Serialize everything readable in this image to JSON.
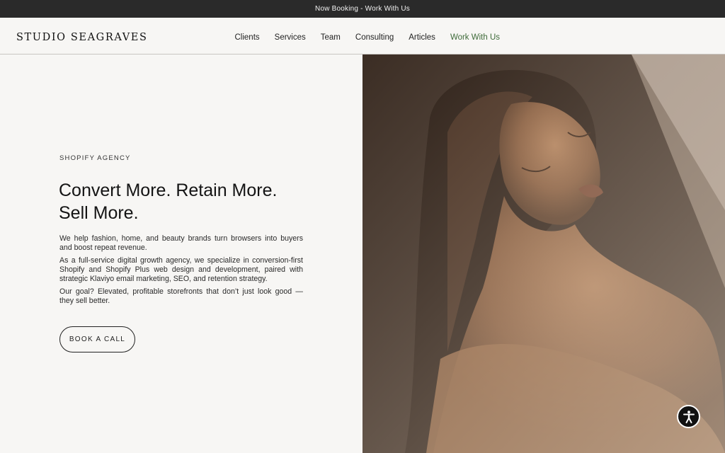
{
  "announcement": {
    "text": "Now Booking - Work With Us"
  },
  "brand": {
    "name": "STUDIO SEAGRAVES"
  },
  "nav": {
    "items": [
      {
        "label": "Clients"
      },
      {
        "label": "Services"
      },
      {
        "label": "Team"
      },
      {
        "label": "Consulting"
      },
      {
        "label": "Articles"
      },
      {
        "label": "Work With Us"
      }
    ]
  },
  "hero": {
    "eyebrow": "SHOPIFY AGENCY",
    "headline_line1": "Convert More. Retain More.",
    "headline_line2": "Sell More.",
    "paragraphs": [
      "We help fashion, home, and beauty brands turn browsers into buyers and boost repeat revenue.",
      "As a full-service digital growth agency, we specialize in conversion-first Shopify and Shopify Plus web design and development, paired with strategic Klaviyo email marketing, SEO, and retention strategy.",
      "Our goal? Elevated, profitable storefronts that don’t just look good — they sell better."
    ],
    "cta_label": "BOOK A CALL",
    "image_icon": "portrait-photo"
  },
  "accessibility": {
    "icon": "accessibility-icon"
  },
  "colors": {
    "announcement_bg": "#2a2a2a",
    "page_bg": "#f7f6f4",
    "accent_nav": "#3f6b3a",
    "text": "#1a1a1a"
  }
}
